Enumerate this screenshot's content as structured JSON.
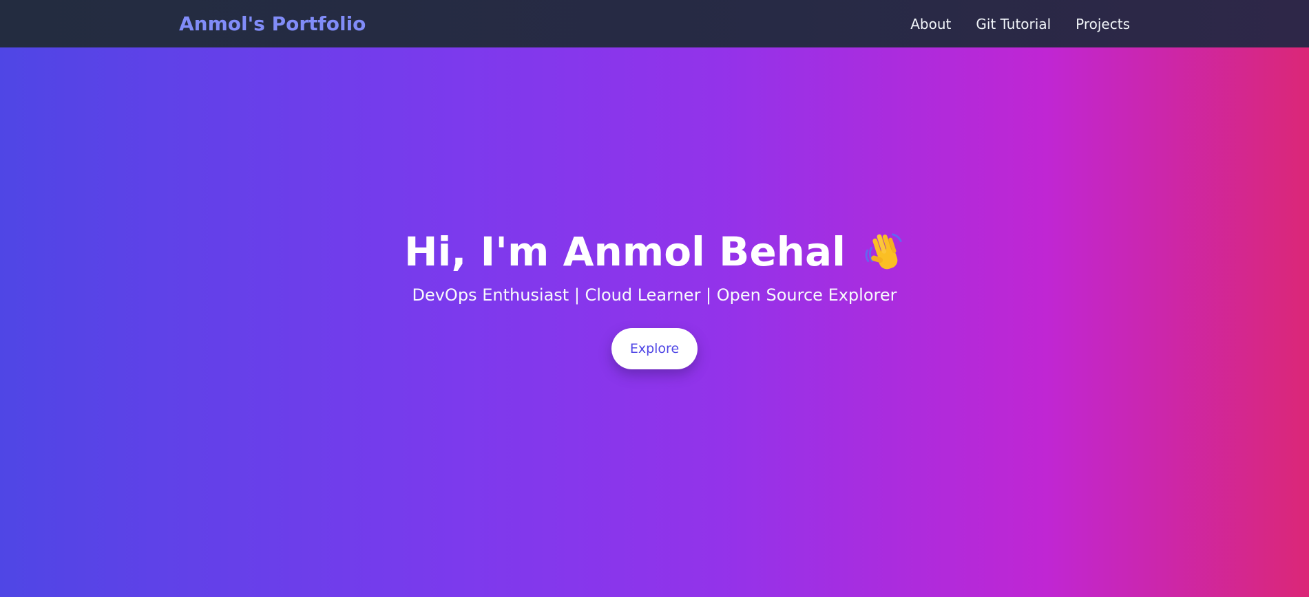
{
  "navbar": {
    "brand": "Anmol's Portfolio",
    "links": [
      {
        "label": "About"
      },
      {
        "label": "Git Tutorial"
      },
      {
        "label": "Projects"
      }
    ]
  },
  "hero": {
    "title": "Hi, I'm Anmol Behal",
    "title_icon": "waving-hand-icon",
    "subtitle": "DevOps Enthusiast | Cloud Learner | Open Source Explorer",
    "button_label": "Explore"
  },
  "colors": {
    "navbar_bg": "#252a43",
    "brand": "#818cf8",
    "gradient_start": "#4f46e5",
    "gradient_mid": "#9333ea",
    "gradient_end": "#db2777",
    "button_text": "#4f46e5"
  }
}
